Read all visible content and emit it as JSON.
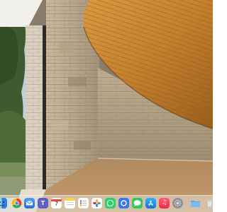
{
  "desktop": {
    "wallpaper": "wood-ceiling-stone-wall-interior"
  },
  "dock": {
    "apps": [
      {
        "name": "finder",
        "icon": "finder-icon",
        "color": "#3a8ee6"
      },
      {
        "name": "chrome",
        "icon": "chrome-icon",
        "color": "#e94235"
      },
      {
        "name": "mail",
        "icon": "mail-icon",
        "color": "#2f7de1"
      },
      {
        "name": "teams",
        "icon": "teams-icon",
        "color": "#5b5fc7"
      },
      {
        "name": "calendar",
        "icon": "calendar-icon",
        "color": "#ffffff",
        "date": "7"
      },
      {
        "name": "notes",
        "icon": "notes-icon",
        "color": "#f6d34a"
      },
      {
        "name": "reminders",
        "icon": "reminders-icon",
        "color": "#ffffff"
      },
      {
        "name": "photos",
        "icon": "photos-icon",
        "color": "#ffffff"
      },
      {
        "name": "whatsapp",
        "icon": "whatsapp-icon",
        "color": "#25d366"
      },
      {
        "name": "signal",
        "icon": "signal-icon",
        "color": "#3a76f0"
      },
      {
        "name": "messages",
        "icon": "messages-icon",
        "color": "#34c759"
      },
      {
        "name": "app-store",
        "icon": "app-store-icon",
        "color": "#1c8cf0"
      },
      {
        "name": "music",
        "icon": "music-icon",
        "color": "#fa2d48"
      },
      {
        "name": "system-settings",
        "icon": "gear-icon",
        "color": "#8e8e93"
      },
      {
        "name": "downloads-folder",
        "icon": "folder-icon",
        "color": "#5aaaf0"
      },
      {
        "name": "trash",
        "icon": "trash-icon",
        "color": "#d8d8d8"
      }
    ]
  }
}
